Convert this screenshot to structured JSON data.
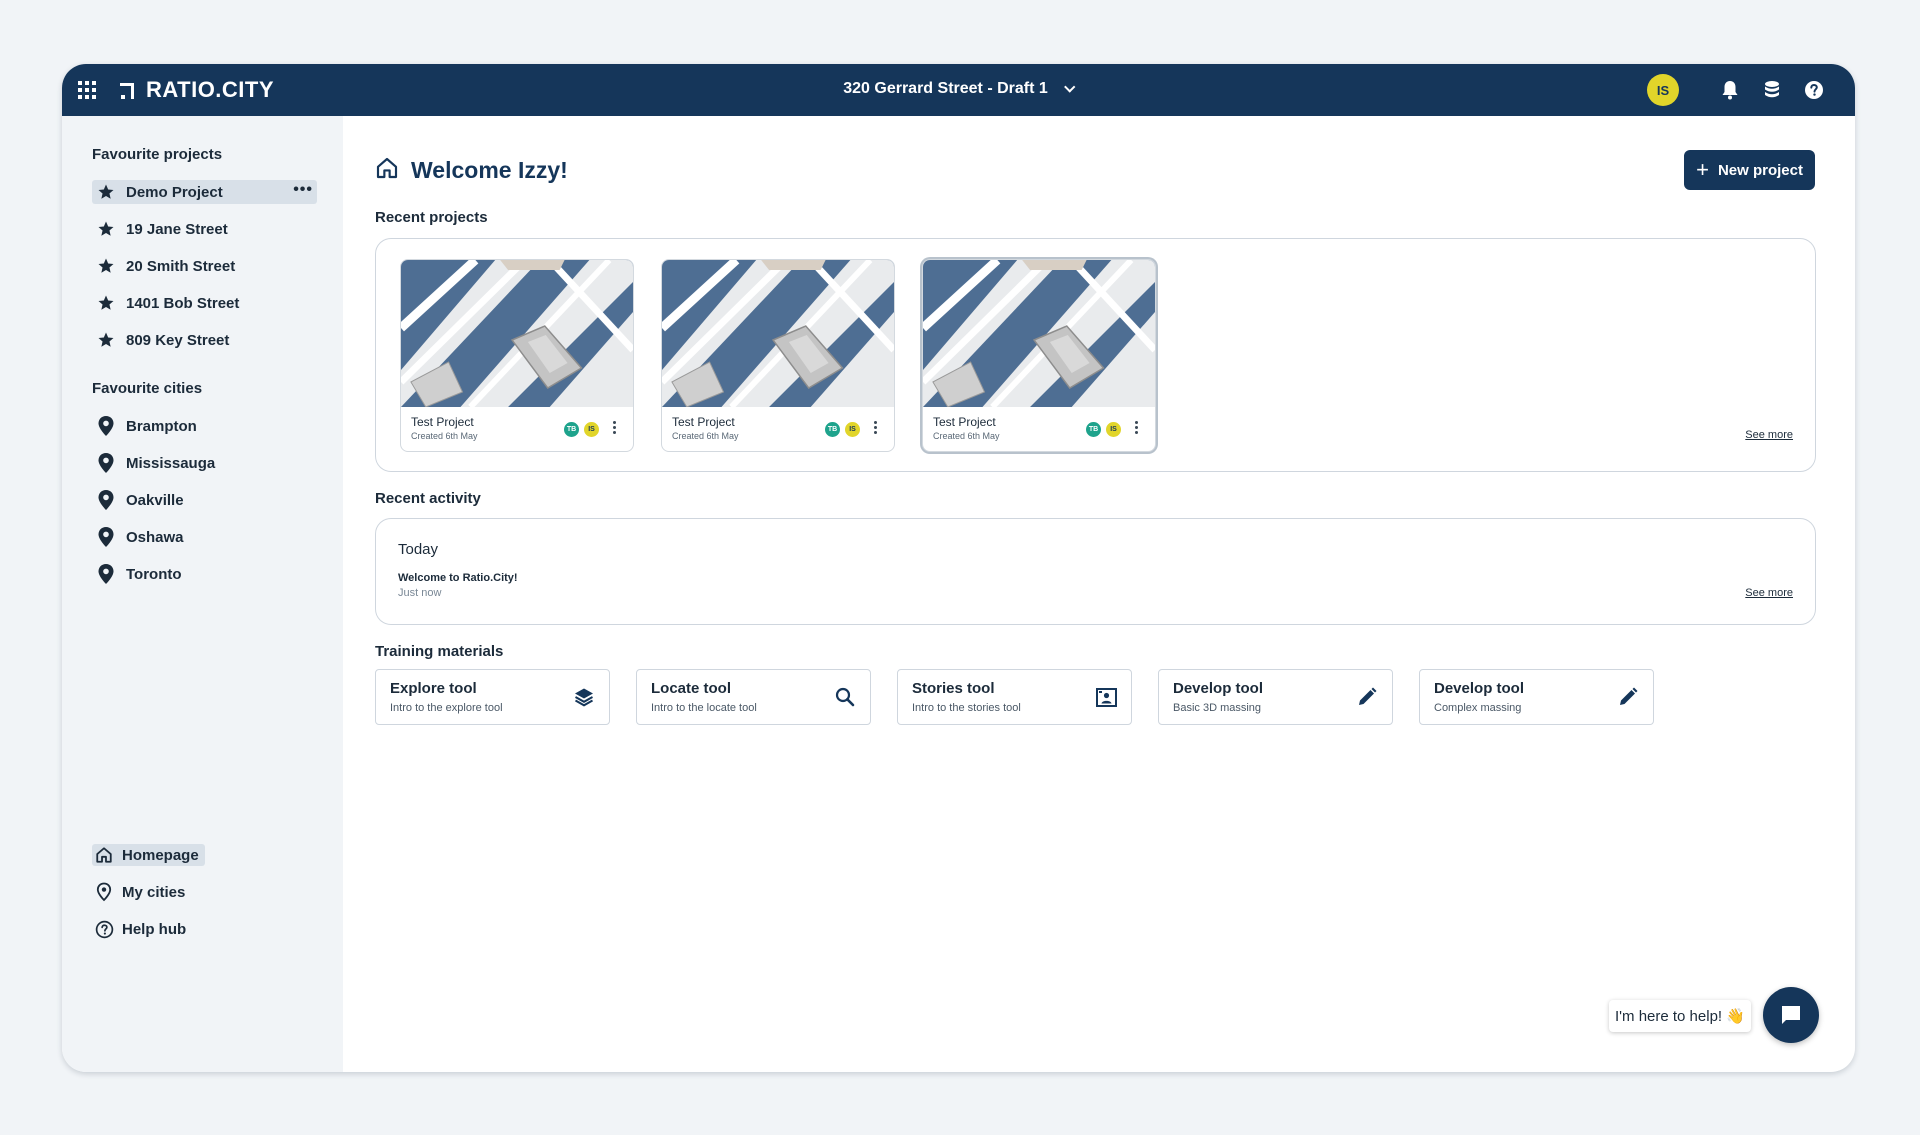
{
  "topbar": {
    "logo": "RATIO.CITY",
    "project_title": "320 Gerrard Street - Draft 1",
    "user_initials": "IS"
  },
  "sidebar": {
    "favourite_projects_heading": "Favourite projects",
    "favourite_projects": [
      {
        "label": "Demo Project",
        "active": true
      },
      {
        "label": "19 Jane Street"
      },
      {
        "label": "20 Smith Street"
      },
      {
        "label": "1401 Bob Street"
      },
      {
        "label": "809 Key Street"
      }
    ],
    "more_label": "•••",
    "favourite_cities_heading": "Favourite cities",
    "favourite_cities": [
      "Brampton",
      "Mississauga",
      "Oakville",
      "Oshawa",
      "Toronto"
    ],
    "bottom_nav": [
      "Homepage",
      "My cities",
      "Help hub"
    ]
  },
  "main": {
    "welcome": "Welcome Izzy!",
    "new_project_label": "New project",
    "recent_projects_title": "Recent projects",
    "recent_projects": [
      {
        "name": "Test Project",
        "created": "Created 6th May",
        "avatars": [
          "TB",
          "IS"
        ]
      },
      {
        "name": "Test Project",
        "created": "Created 6th May",
        "avatars": [
          "TB",
          "IS"
        ]
      },
      {
        "name": "Test Project",
        "created": "Created 6th May",
        "avatars": [
          "TB",
          "IS"
        ]
      }
    ],
    "see_more": "See more",
    "recent_activity_title": "Recent activity",
    "activity": {
      "day": "Today",
      "title": "Welcome to Ratio.City!",
      "time": "Just now"
    },
    "training_title": "Training materials",
    "training": [
      {
        "title": "Explore tool",
        "subtitle": "Intro to the explore tool",
        "icon": "layers-icon"
      },
      {
        "title": "Locate tool",
        "subtitle": "Intro to the locate tool",
        "icon": "search-icon"
      },
      {
        "title": "Stories tool",
        "subtitle": "Intro to the stories tool",
        "icon": "stories-icon"
      },
      {
        "title": "Develop tool",
        "subtitle": "Basic 3D massing",
        "icon": "pencil-icon"
      },
      {
        "title": "Develop tool",
        "subtitle": "Complex massing",
        "icon": "pencil-icon"
      }
    ]
  },
  "help": {
    "bubble": "I'm here to help! 👋"
  },
  "colors": {
    "navy": "#15365a",
    "accent_yellow": "#e1d52a",
    "accent_teal": "#1ea38c",
    "sidebar_bg": "#f1f4f7"
  }
}
